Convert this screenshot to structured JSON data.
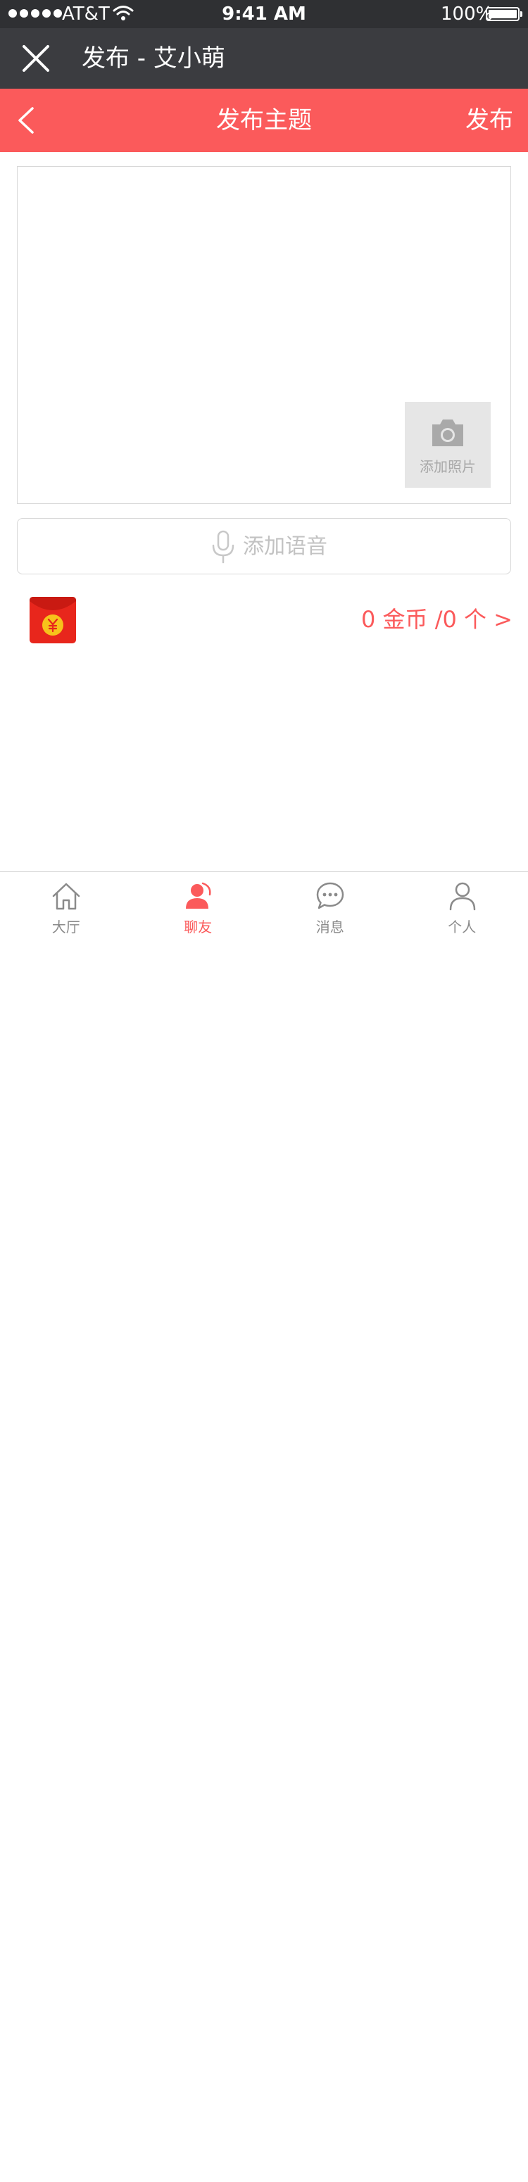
{
  "status_bar": {
    "carrier": "AT&T",
    "time": "9:41 AM",
    "battery": "100%"
  },
  "window": {
    "title": "发布 - 艾小萌"
  },
  "nav": {
    "title": "发布主题",
    "publish_label": "发布"
  },
  "composer": {
    "add_photo_label": "添加照片",
    "add_voice_label": "添加语音"
  },
  "red_packet": {
    "coins_text": "0 金币 /0 个 >"
  },
  "tabs": [
    {
      "label": "大厅",
      "icon": "home-icon",
      "active": false
    },
    {
      "label": "聊友",
      "icon": "chat-friends-icon",
      "active": true
    },
    {
      "label": "消息",
      "icon": "message-icon",
      "active": false
    },
    {
      "label": "个人",
      "icon": "person-icon",
      "active": false
    }
  ],
  "colors": {
    "accent": "#fb5a5b",
    "header_dark": "#3b3c40",
    "status_bar": "#2f3033"
  }
}
